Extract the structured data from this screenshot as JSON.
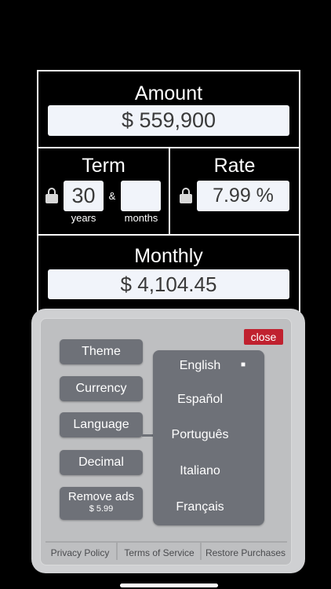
{
  "amount": {
    "title": "Amount",
    "value": "$ 559,900"
  },
  "term": {
    "title": "Term",
    "years_value": "30",
    "amp": "&",
    "months_value": "",
    "years_label": "years",
    "months_label": "months"
  },
  "rate": {
    "title": "Rate",
    "value": "7.99 %"
  },
  "monthly": {
    "title": "Monthly",
    "value": "$ 4,104.45"
  },
  "settings": {
    "close_label": "close",
    "menu": [
      {
        "label": "Theme"
      },
      {
        "label": "Currency"
      },
      {
        "label": "Language"
      },
      {
        "label": "Decimal"
      },
      {
        "label": "Remove ads",
        "price": "$ 5.99"
      }
    ],
    "languages": [
      {
        "label": "English",
        "selected": true
      },
      {
        "label": "Español"
      },
      {
        "label": "Português"
      },
      {
        "label": "Italiano"
      },
      {
        "label": "Français"
      }
    ],
    "selected_marker": "■",
    "footer": {
      "privacy": "Privacy Policy",
      "terms": "Terms of Service",
      "restore": "Restore Purchases"
    }
  },
  "colors": {
    "background": "#000000",
    "field": "#f1f4fa",
    "panel": "#cfd0d2",
    "button": "#6e7178",
    "close": "#c0212f"
  },
  "icons": {
    "term_lock": "lock-icon",
    "rate_lock": "lock-icon"
  }
}
